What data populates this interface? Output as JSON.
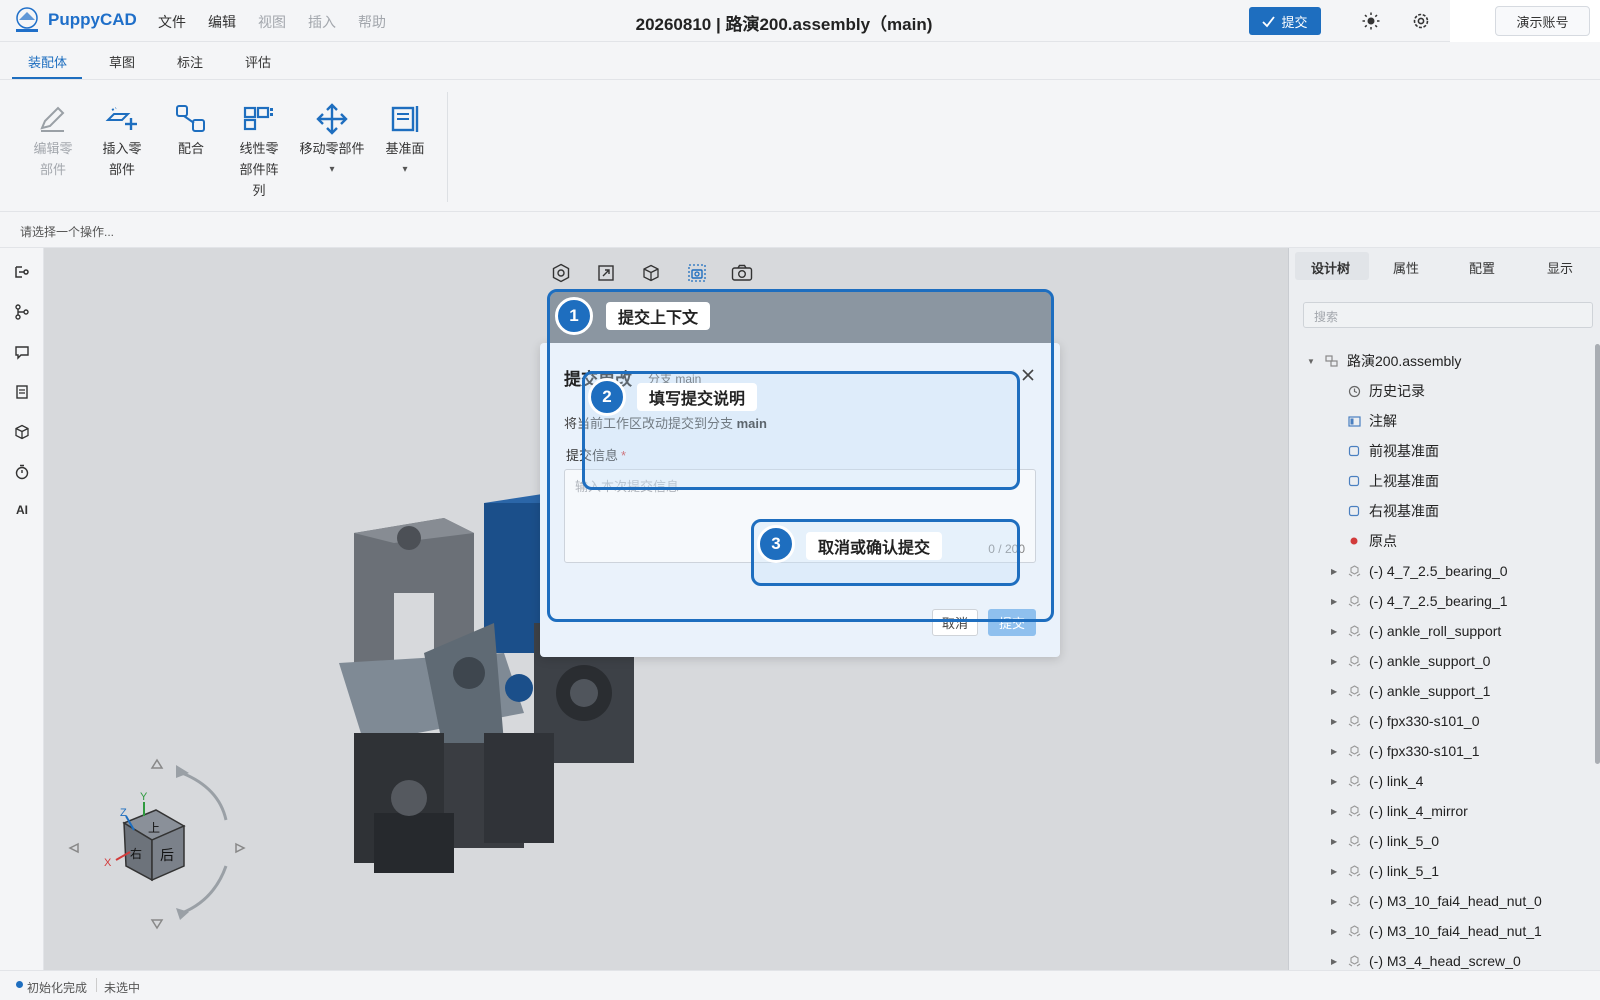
{
  "header": {
    "app_name": "PuppyCAD",
    "menu": [
      "文件",
      "编辑",
      "视图",
      "插入",
      "帮助"
    ],
    "doc_title": "20260810 | 路演200.assembly（main)",
    "commit_label": "提交",
    "account_label": "演示账号"
  },
  "ribbon": {
    "tabs": [
      "装配体",
      "草图",
      "标注",
      "评估"
    ],
    "tools": [
      {
        "label_1": "编辑零",
        "label_2": "部件",
        "label_3": ""
      },
      {
        "label_1": "插入零",
        "label_2": "部件",
        "label_3": ""
      },
      {
        "label_1": "配合",
        "label_2": "",
        "label_3": ""
      },
      {
        "label_1": "线性零",
        "label_2": "部件阵",
        "label_3": "列"
      },
      {
        "label_1": "移动零部件",
        "label_2": "▾",
        "label_3": ""
      },
      {
        "label_1": "基准面",
        "label_2": "▾",
        "label_3": ""
      }
    ]
  },
  "hint": "请选择一个操作...",
  "left_rail": {
    "ai_label": "AI"
  },
  "right_panel": {
    "tabs": [
      "设计树",
      "属性",
      "配置",
      "显示"
    ],
    "search_placeholder": "搜索",
    "tree": {
      "root": "路演200.assembly",
      "fixed_items": [
        "历史记录",
        "注解",
        "前视基准面",
        "上视基准面",
        "右视基准面",
        "原点"
      ],
      "parts": [
        "(-) 4_7_2.5_bearing_0",
        "(-) 4_7_2.5_bearing_1",
        "(-) ankle_roll_support",
        "(-) ankle_support_0",
        "(-) ankle_support_1",
        "(-) fpx330-s101_0",
        "(-) fpx330-s101_1",
        "(-) link_4",
        "(-) link_4_mirror",
        "(-) link_5_0",
        "(-) link_5_1",
        "(-) M3_10_fai4_head_nut_0",
        "(-) M3_10_fai4_head_nut_1",
        "(-) M3_4_head_screw_0"
      ]
    }
  },
  "viewcube": {
    "x": "X",
    "y": "Y",
    "z": "Z",
    "face_top": "上",
    "face_right": "右",
    "face_back": "后"
  },
  "status": {
    "state": "初始化完成",
    "selection": "未选中"
  },
  "dialog": {
    "title": "提交更改",
    "branch": "分支 main",
    "desc_prefix": "将当前工作区改动提交到分支 ",
    "desc_branch": "main",
    "field_label": "提交信息",
    "required_mark": "*",
    "placeholder": "输入本次提交信息",
    "counter": "0 / 200",
    "cancel_label": "取消",
    "ok_label": "提交"
  },
  "tour": {
    "steps": [
      {
        "num": "1",
        "label": "提交上下文"
      },
      {
        "num": "2",
        "label": "填写提交说明"
      },
      {
        "num": "3",
        "label": "取消或确认提交"
      }
    ]
  },
  "colors": {
    "accent": "#1e6ebf",
    "disabled_ok": "#8fc0ee"
  }
}
